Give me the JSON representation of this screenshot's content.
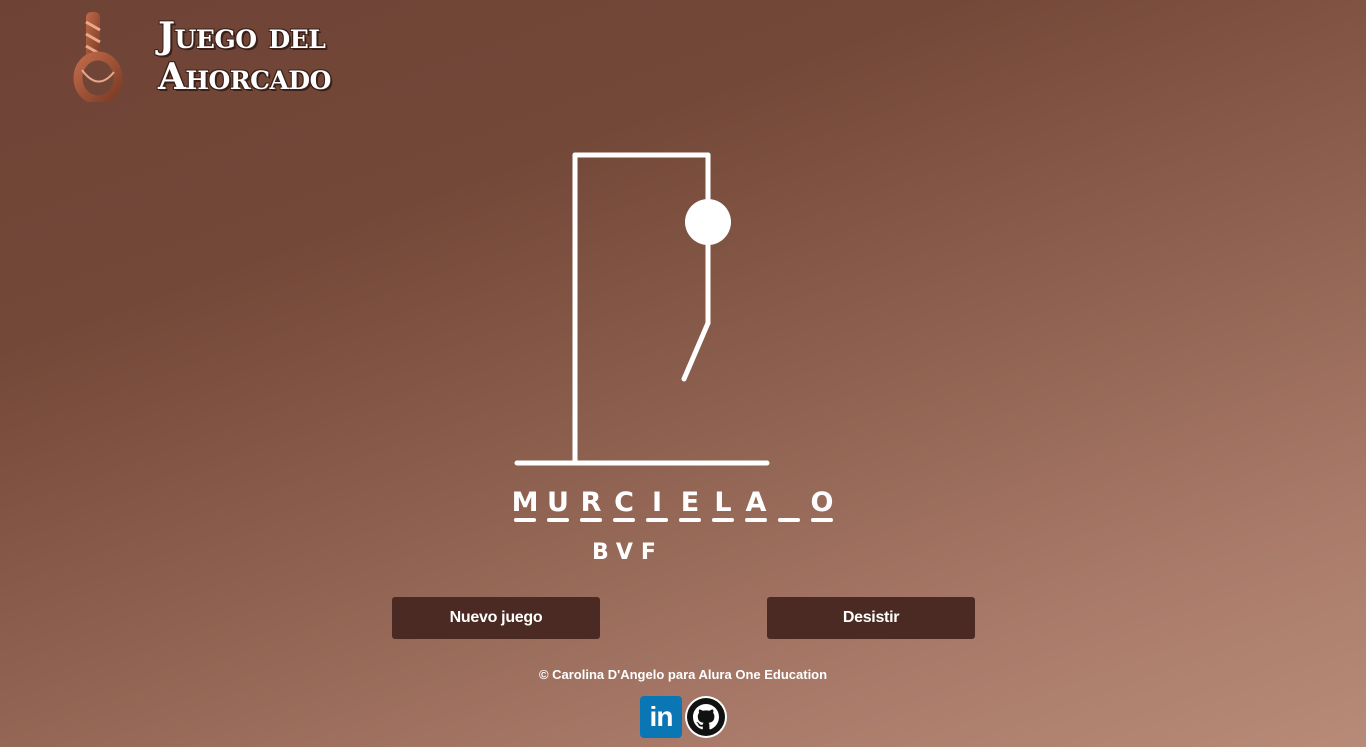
{
  "header": {
    "title_line1": "Juego del",
    "title_line2": "Ahorcado",
    "logo_icon": "noose-icon"
  },
  "game": {
    "word_slots": [
      "M",
      "U",
      "R",
      "C",
      "I",
      "E",
      "L",
      "A",
      "",
      "O"
    ],
    "wrong_letters": "BVF"
  },
  "buttons": {
    "new_game": "Nuevo juego",
    "quit": "Desistir"
  },
  "footer": {
    "credit": "© Carolina D'Angelo para Alura One Education",
    "linkedin_label": "in",
    "social_icons": [
      "linkedin-icon",
      "github-icon"
    ]
  },
  "colors": {
    "button_bg": "#4a2a22",
    "linkedin_blue": "#0a76b4",
    "drawing": "#ffffff"
  }
}
